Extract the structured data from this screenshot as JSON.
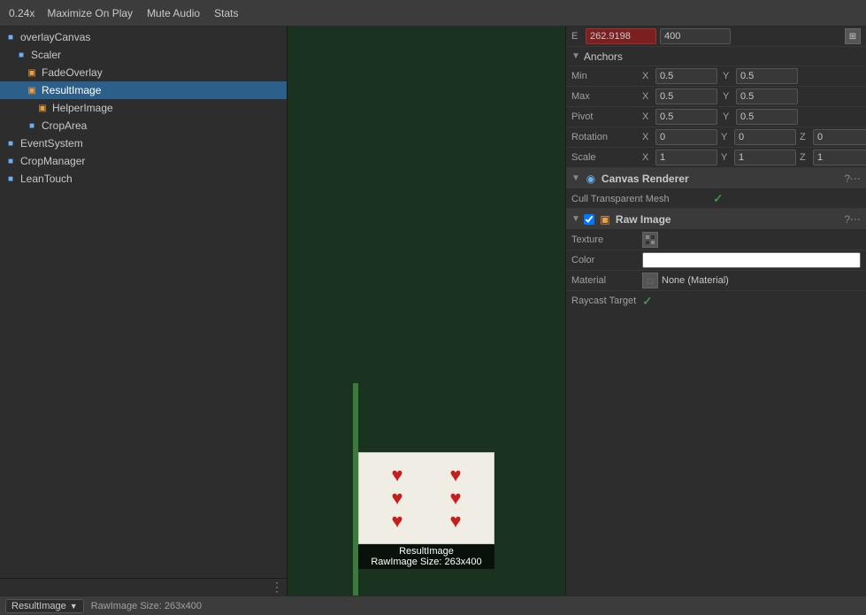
{
  "toolbar": {
    "zoom": "0.24x",
    "maximize_on_play": "Maximize On Play",
    "mute_audio": "Mute Audio",
    "stats": "Stats"
  },
  "hierarchy": {
    "items": [
      {
        "id": "overlaycanvas",
        "label": "overlayCanvas",
        "indent": 0,
        "icon": "cube",
        "selected": false
      },
      {
        "id": "scaler",
        "label": "Scaler",
        "indent": 1,
        "icon": "cube",
        "selected": false
      },
      {
        "id": "fadeoverlay",
        "label": "FadeOverlay",
        "indent": 2,
        "icon": "image",
        "selected": false
      },
      {
        "id": "resultimage",
        "label": "ResultImage",
        "indent": 2,
        "icon": "image",
        "selected": true
      },
      {
        "id": "helperimage",
        "label": "HelperImage",
        "indent": 3,
        "icon": "image",
        "selected": false
      },
      {
        "id": "croparea",
        "label": "CropArea",
        "indent": 2,
        "icon": "cube",
        "selected": false
      },
      {
        "id": "eventsystem",
        "label": "EventSystem",
        "indent": 0,
        "icon": "cube",
        "selected": false
      },
      {
        "id": "cropmanager",
        "label": "CropManager",
        "indent": 0,
        "icon": "cube",
        "selected": false
      },
      {
        "id": "leantouch",
        "label": "LeanTouch",
        "indent": 0,
        "icon": "cube",
        "selected": false
      }
    ],
    "dots_button": "⋮"
  },
  "inspector": {
    "top_row": {
      "value1": "262.9198",
      "value2": "400"
    },
    "anchors_section": {
      "title": "Anchors",
      "min_label": "Min",
      "min_x_label": "X",
      "min_x_value": "0.5",
      "min_y_label": "Y",
      "min_y_value": "0.5",
      "max_label": "Max",
      "max_x_label": "X",
      "max_x_value": "0.5",
      "max_y_label": "Y",
      "max_y_value": "0.5"
    },
    "pivot": {
      "label": "Pivot",
      "x_label": "X",
      "x_value": "0.5",
      "y_label": "Y",
      "y_value": "0.5"
    },
    "rotation": {
      "label": "Rotation",
      "x_label": "X",
      "x_value": "0",
      "y_label": "Y",
      "y_value": "0",
      "z_label": "Z",
      "z_value": "0"
    },
    "scale": {
      "label": "Scale",
      "x_label": "X",
      "x_value": "1",
      "y_label": "Y",
      "y_value": "1",
      "z_label": "Z",
      "z_value": "1"
    },
    "canvas_renderer": {
      "title": "Canvas Renderer",
      "cull_label": "Cull Transparent Mesh",
      "checkmark": "✓"
    },
    "raw_image": {
      "title": "Raw Image",
      "texture_label": "Texture",
      "color_label": "Color",
      "material_label": "Material",
      "material_value": "None (Material)",
      "raycast_label": "Raycast Target",
      "raycast_check": "✓"
    }
  },
  "bottom_bar": {
    "result_image_label": "ResultImage",
    "dropdown_arrow": "▼",
    "raw_image_size": "RawImage Size: 263x400"
  },
  "card_preview": {
    "title": "ResultImage",
    "size_label": "RawImage Size: 263x400"
  }
}
